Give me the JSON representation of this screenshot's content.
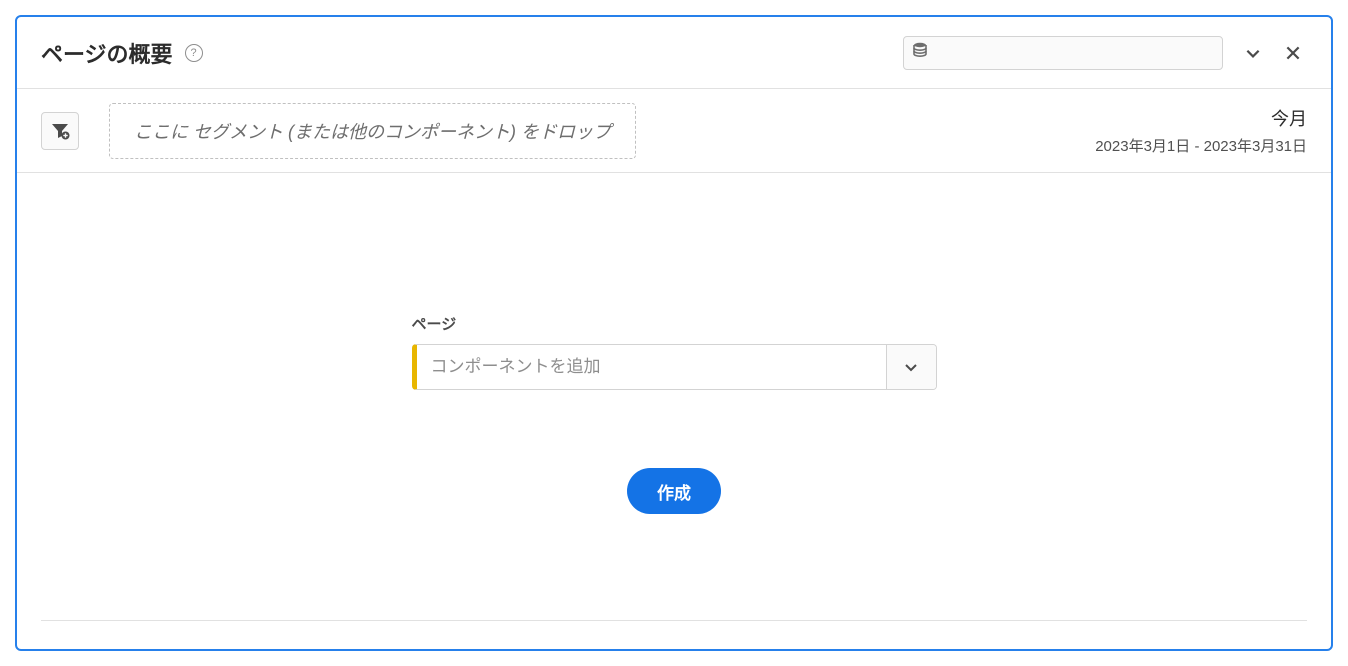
{
  "header": {
    "title": "ページの概要"
  },
  "toolbar": {
    "drop_hint": "ここに セグメント (または他のコンポーネント) をドロップ"
  },
  "date": {
    "label": "今月",
    "range": "2023年3月1日 - 2023年3月31日"
  },
  "form": {
    "page_label": "ページ",
    "component_placeholder": "コンポーネントを追加",
    "create_label": "作成"
  }
}
